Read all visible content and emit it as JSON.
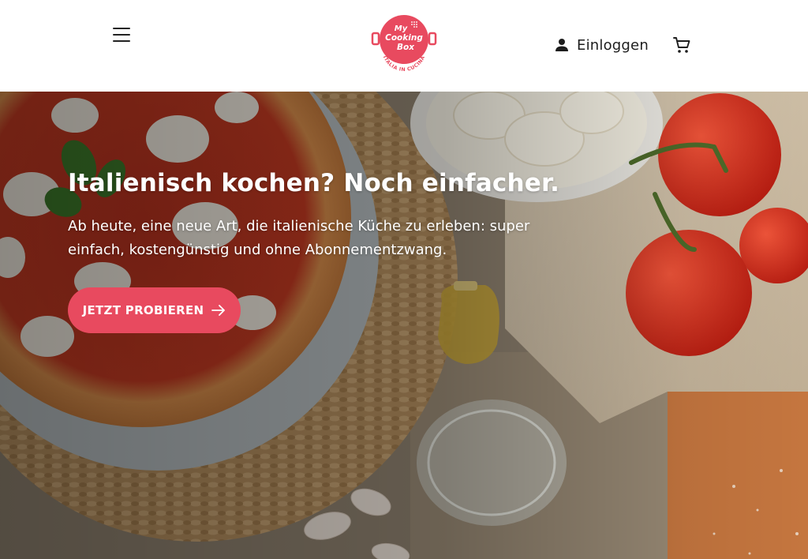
{
  "header": {
    "menu_icon": "hamburger-menu-icon",
    "logo": {
      "line1": "My",
      "line2": "Cooking",
      "line3": "Box",
      "tagline": "ITALIA IN CUCINA",
      "color": "#e84a5f"
    },
    "login_label": "Einloggen",
    "login_icon": "user-icon",
    "cart_icon": "shopping-cart-icon"
  },
  "hero": {
    "title": "Italienisch kochen? Noch einfacher.",
    "subtitle_line1": "Ab heute, eine neue Art, die italienische Küche zu erleben: super",
    "subtitle_line2": "einfach, kostengünstig und ohne Abonnementzwang.",
    "cta_label": "JETZT PROBIEREN",
    "cta_icon": "arrow-right-icon",
    "accent_color": "#e84a5f"
  }
}
